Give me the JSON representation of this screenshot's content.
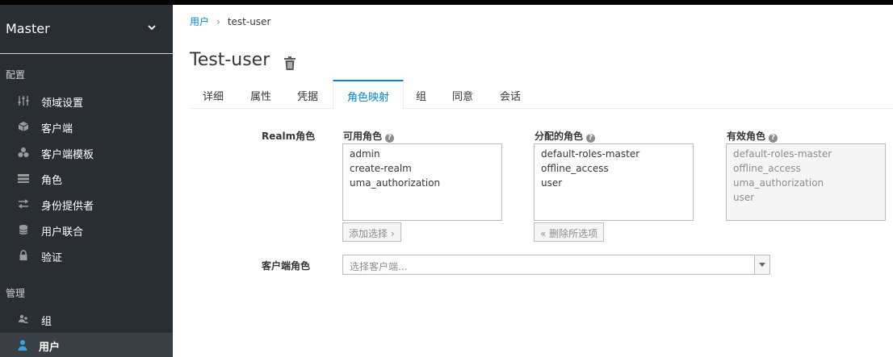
{
  "sidebar": {
    "realm": "Master",
    "config_section": "配置",
    "manage_section": "管理",
    "config_items": [
      {
        "label": "领域设置",
        "icon": "sliders-icon"
      },
      {
        "label": "客户端",
        "icon": "cube-icon"
      },
      {
        "label": "客户端模板",
        "icon": "cubes-icon"
      },
      {
        "label": "角色",
        "icon": "list-icon"
      },
      {
        "label": "身份提供者",
        "icon": "exchange-icon"
      },
      {
        "label": "用户联合",
        "icon": "database-icon"
      },
      {
        "label": "验证",
        "icon": "lock-icon"
      }
    ],
    "manage_items": [
      {
        "label": "组",
        "icon": "users-icon"
      },
      {
        "label": "用户",
        "icon": "user-icon"
      }
    ]
  },
  "breadcrumb": {
    "parent": "用户",
    "current": "test-user"
  },
  "page_title": "Test-user",
  "tabs": [
    "详细",
    "属性",
    "凭据",
    "角色映射",
    "组",
    "同意",
    "会话"
  ],
  "active_tab": "角色映射",
  "role_mapping": {
    "realm_roles_label": "Realm角色",
    "available": {
      "header": "可用角色",
      "items": [
        "admin",
        "create-realm",
        "uma_authorization"
      ],
      "button": "添加选择 ›"
    },
    "assigned": {
      "header": "分配的角色",
      "items": [
        "default-roles-master",
        "offline_access",
        "user"
      ],
      "button": "« 删除所选项"
    },
    "effective": {
      "header": "有效角色",
      "items": [
        "default-roles-master",
        "offline_access",
        "uma_authorization",
        "user"
      ]
    },
    "client_roles_label": "客户端角色",
    "client_select_placeholder": "选择客户端..."
  },
  "colors": {
    "accent": "#0088ce",
    "sidebar_bg": "#292e34",
    "sidebar_active": "#393f44"
  }
}
